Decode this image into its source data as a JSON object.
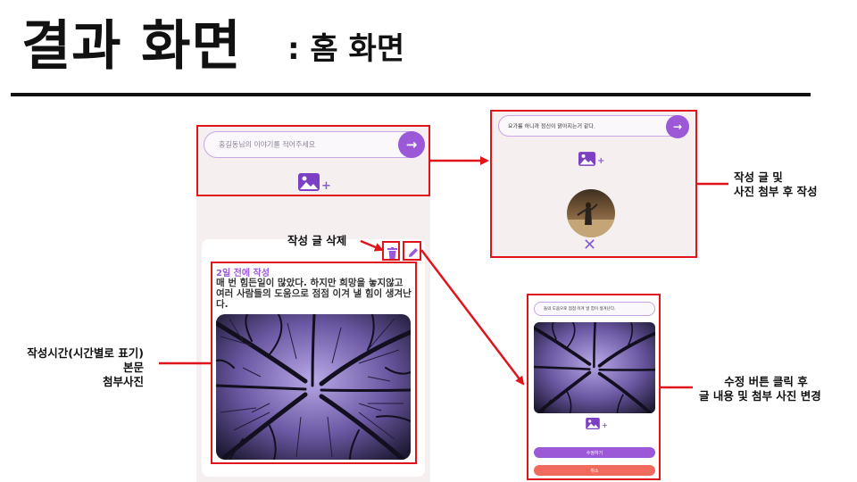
{
  "slide": {
    "title": "결과 화면",
    "subtitle": ": 홈 화면"
  },
  "colors": {
    "accent_purple": "#9b59d8",
    "annotation_red": "#e0141b",
    "cancel_red": "#f06a5d",
    "panel_bg": "#f5efef"
  },
  "home": {
    "input_placeholder": "홍길동님의 이야기를 적어주세요",
    "submit_icon": "arrow-right-icon",
    "image_add_icon": "image-add-icon",
    "post": {
      "time": "2일 전에 작성",
      "body": "매 번 힘든일이 많았다. 하지만 희망을 놓지않고 여러 사람들의 도움으로 점점 이겨 낼 힘이 생겨난다.",
      "photo": "bare-trees-purple-sky-photo",
      "delete_icon": "trash-icon",
      "edit_icon": "pencil-icon"
    }
  },
  "compose_preview": {
    "input_text": "요가를 하니까 정신이 맑아지는거 같다.",
    "thumbnail": "person-in-field-photo",
    "remove_icon": "close-icon"
  },
  "edit_preview": {
    "input_text": "들의 도움으로 점점 이겨 낼 힘이 생겨난다.",
    "save_label": "수정하기",
    "cancel_label": "취소"
  },
  "annotations": {
    "delete": "작성 글 삭제",
    "compose": [
      "작성 글 및",
      "사진 첨부 후 작성"
    ],
    "meta": [
      "작성시간(시간별로 표기)",
      "본문",
      "첨부사진"
    ],
    "edit": [
      "수정 버튼 클릭 후",
      "글 내용 및 첨부 사진 변경"
    ]
  }
}
